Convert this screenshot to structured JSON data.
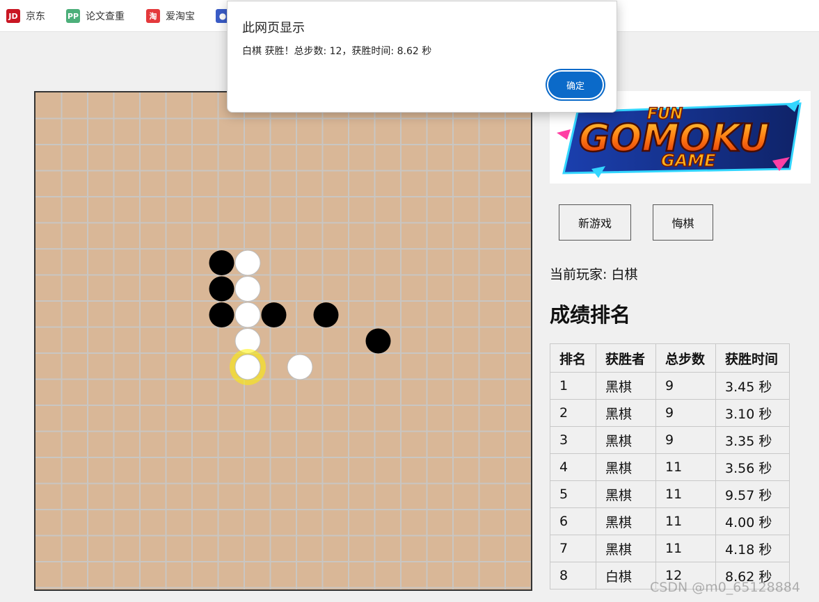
{
  "bookmarks": [
    {
      "label": "京东",
      "icon_text": "JD",
      "icon": "jd-icon",
      "color": "#c91623"
    },
    {
      "label": "论文查重",
      "icon_text": "PP",
      "icon": "pp-icon",
      "color": "#4caf7a"
    },
    {
      "label": "爱淘宝",
      "icon_text": "淘",
      "icon": "taobao-icon",
      "color": "#e4393c"
    },
    {
      "label": "",
      "icon_text": "🤖",
      "icon": "robot-icon",
      "color": "#3a5cc7"
    }
  ],
  "dialog": {
    "title": "此网页显示",
    "message": "白棋 获胜！总步数: 12，获胜时间: 8.62 秒",
    "ok_label": "确定"
  },
  "game": {
    "grid_lines": 19,
    "stones": [
      {
        "col": 7,
        "row": 6,
        "color": "black"
      },
      {
        "col": 8,
        "row": 6,
        "color": "white"
      },
      {
        "col": 7,
        "row": 7,
        "color": "black"
      },
      {
        "col": 8,
        "row": 7,
        "color": "white"
      },
      {
        "col": 7,
        "row": 8,
        "color": "black"
      },
      {
        "col": 8,
        "row": 8,
        "color": "white"
      },
      {
        "col": 9,
        "row": 8,
        "color": "black"
      },
      {
        "col": 11,
        "row": 8,
        "color": "black"
      },
      {
        "col": 8,
        "row": 9,
        "color": "white"
      },
      {
        "col": 13,
        "row": 9,
        "color": "black"
      },
      {
        "col": 8,
        "row": 10,
        "color": "white",
        "highlight": true
      },
      {
        "col": 10,
        "row": 10,
        "color": "white"
      }
    ]
  },
  "logo": {
    "top_text": "FUN",
    "main_text": "GOMOKU",
    "sub_text": "GAME"
  },
  "buttons": {
    "new_game": "新游戏",
    "undo": "悔棋"
  },
  "status": {
    "current_player": "当前玩家: 白棋"
  },
  "ranking": {
    "title": "成绩排名",
    "headers": [
      "排名",
      "获胜者",
      "总步数",
      "获胜时间"
    ],
    "rows": [
      [
        "1",
        "黑棋",
        "9",
        "3.45 秒"
      ],
      [
        "2",
        "黑棋",
        "9",
        "3.10 秒"
      ],
      [
        "3",
        "黑棋",
        "9",
        "3.35 秒"
      ],
      [
        "4",
        "黑棋",
        "11",
        "3.56 秒"
      ],
      [
        "5",
        "黑棋",
        "11",
        "9.57 秒"
      ],
      [
        "6",
        "黑棋",
        "11",
        "4.00 秒"
      ],
      [
        "7",
        "黑棋",
        "11",
        "4.18 秒"
      ],
      [
        "8",
        "白棋",
        "12",
        "8.62 秒"
      ]
    ]
  },
  "watermark": "CSDN @m0_65128884"
}
